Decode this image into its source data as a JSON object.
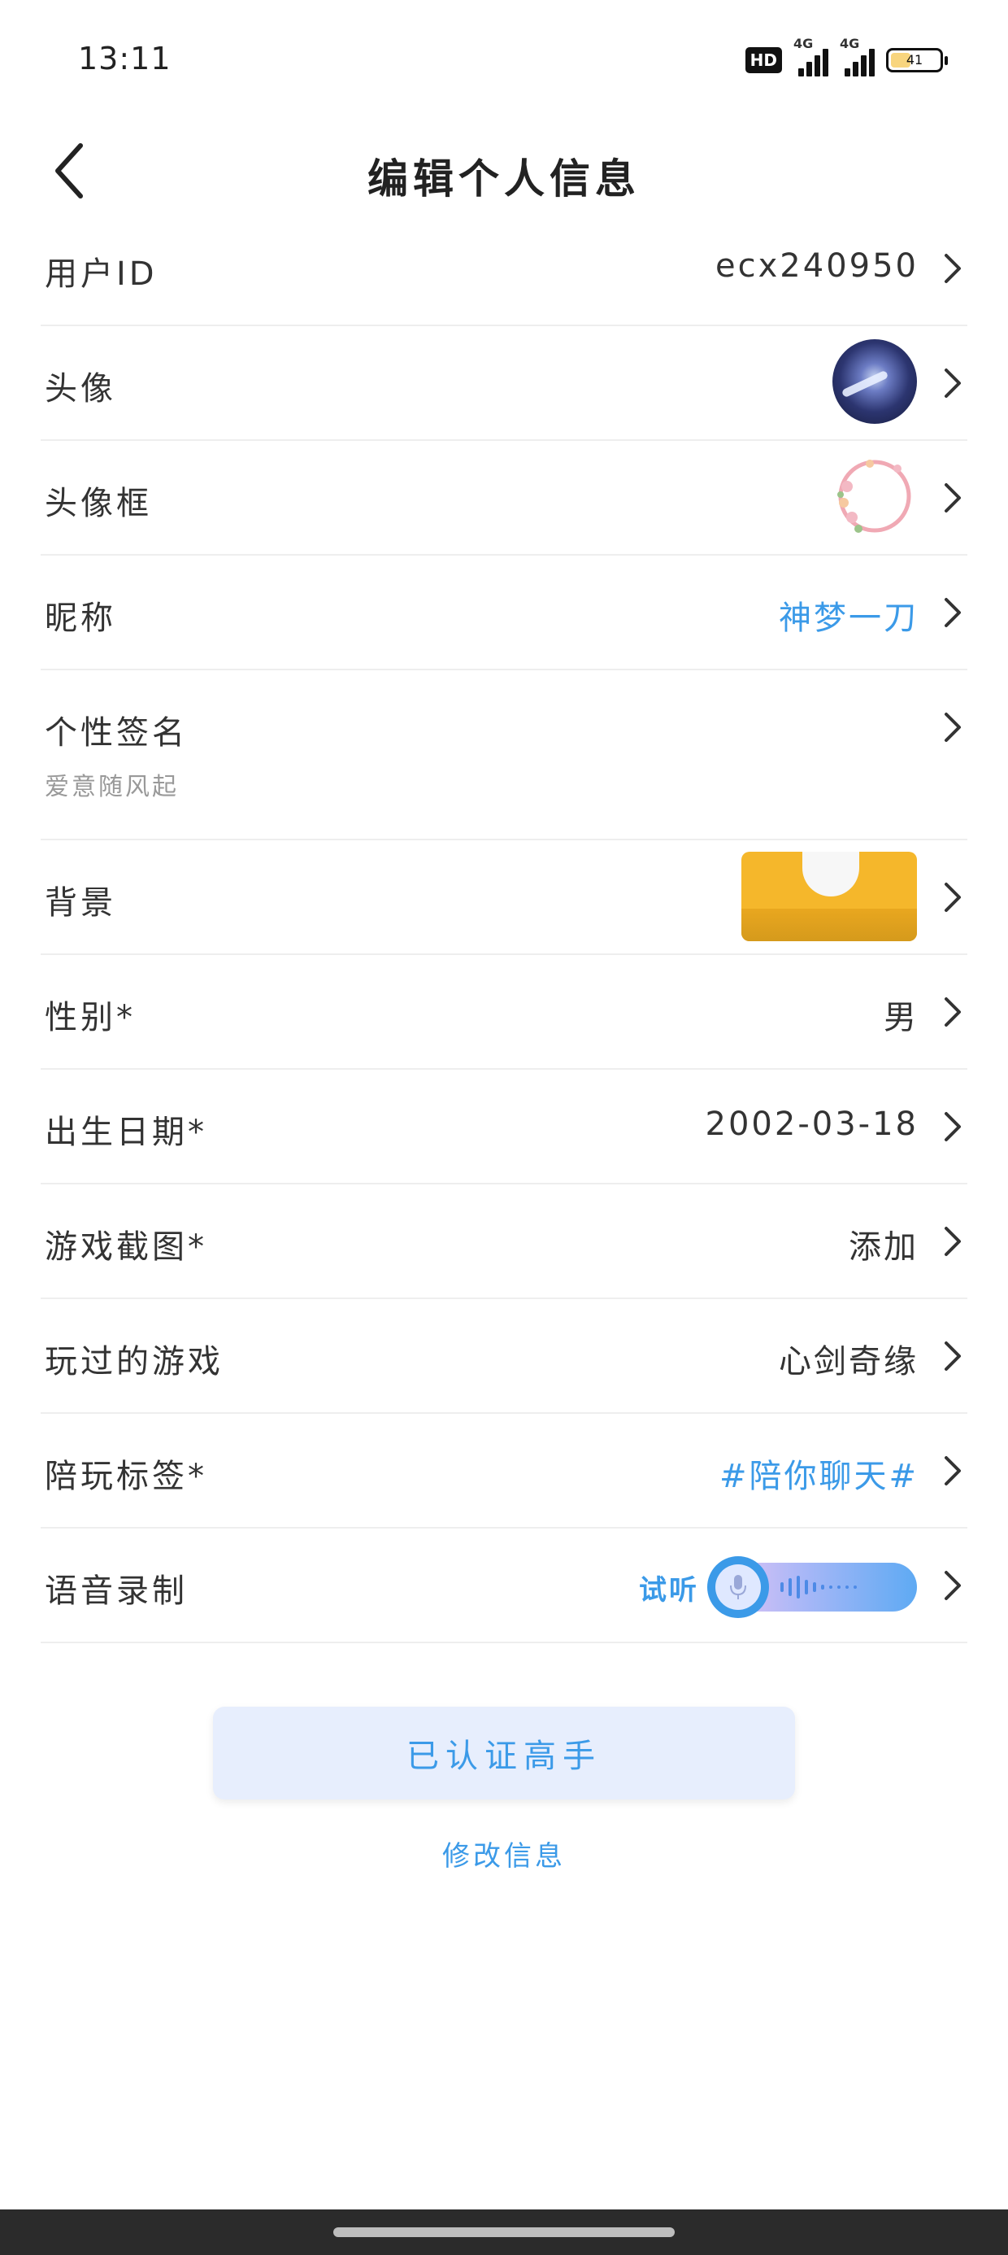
{
  "status_bar": {
    "time": "13:11",
    "hd_label": "HD",
    "network_1": "4G",
    "network_2": "4G",
    "battery_level": "41",
    "battery_fraction": 0.41
  },
  "header": {
    "title": "编辑个人信息"
  },
  "rows": {
    "user_id": {
      "label": "用户ID",
      "value": "ecx240950"
    },
    "avatar": {
      "label": "头像"
    },
    "avatar_frame": {
      "label": "头像框"
    },
    "nickname": {
      "label": "昵称",
      "value": "神梦一刀"
    },
    "signature": {
      "label": "个性签名",
      "value": "爱意随风起"
    },
    "background": {
      "label": "背景"
    },
    "gender": {
      "label": "性别*",
      "value": "男"
    },
    "birthday": {
      "label": "出生日期*",
      "value": "2002-03-18"
    },
    "game_screenshot": {
      "label": "游戏截图*",
      "value": "添加"
    },
    "played_games": {
      "label": "玩过的游戏",
      "value": "心剑奇缘"
    },
    "tags": {
      "label": "陪玩标签*",
      "value": "#陪你聊天#"
    },
    "voice": {
      "label": "语音录制",
      "listen": "试听"
    }
  },
  "buttons": {
    "verified": "已认证高手",
    "edit_info": "修改信息"
  },
  "colors": {
    "accent": "#3b9ae8",
    "text": "#333333",
    "divider": "#eeeeee",
    "verified_bg": "#e7eefd"
  }
}
